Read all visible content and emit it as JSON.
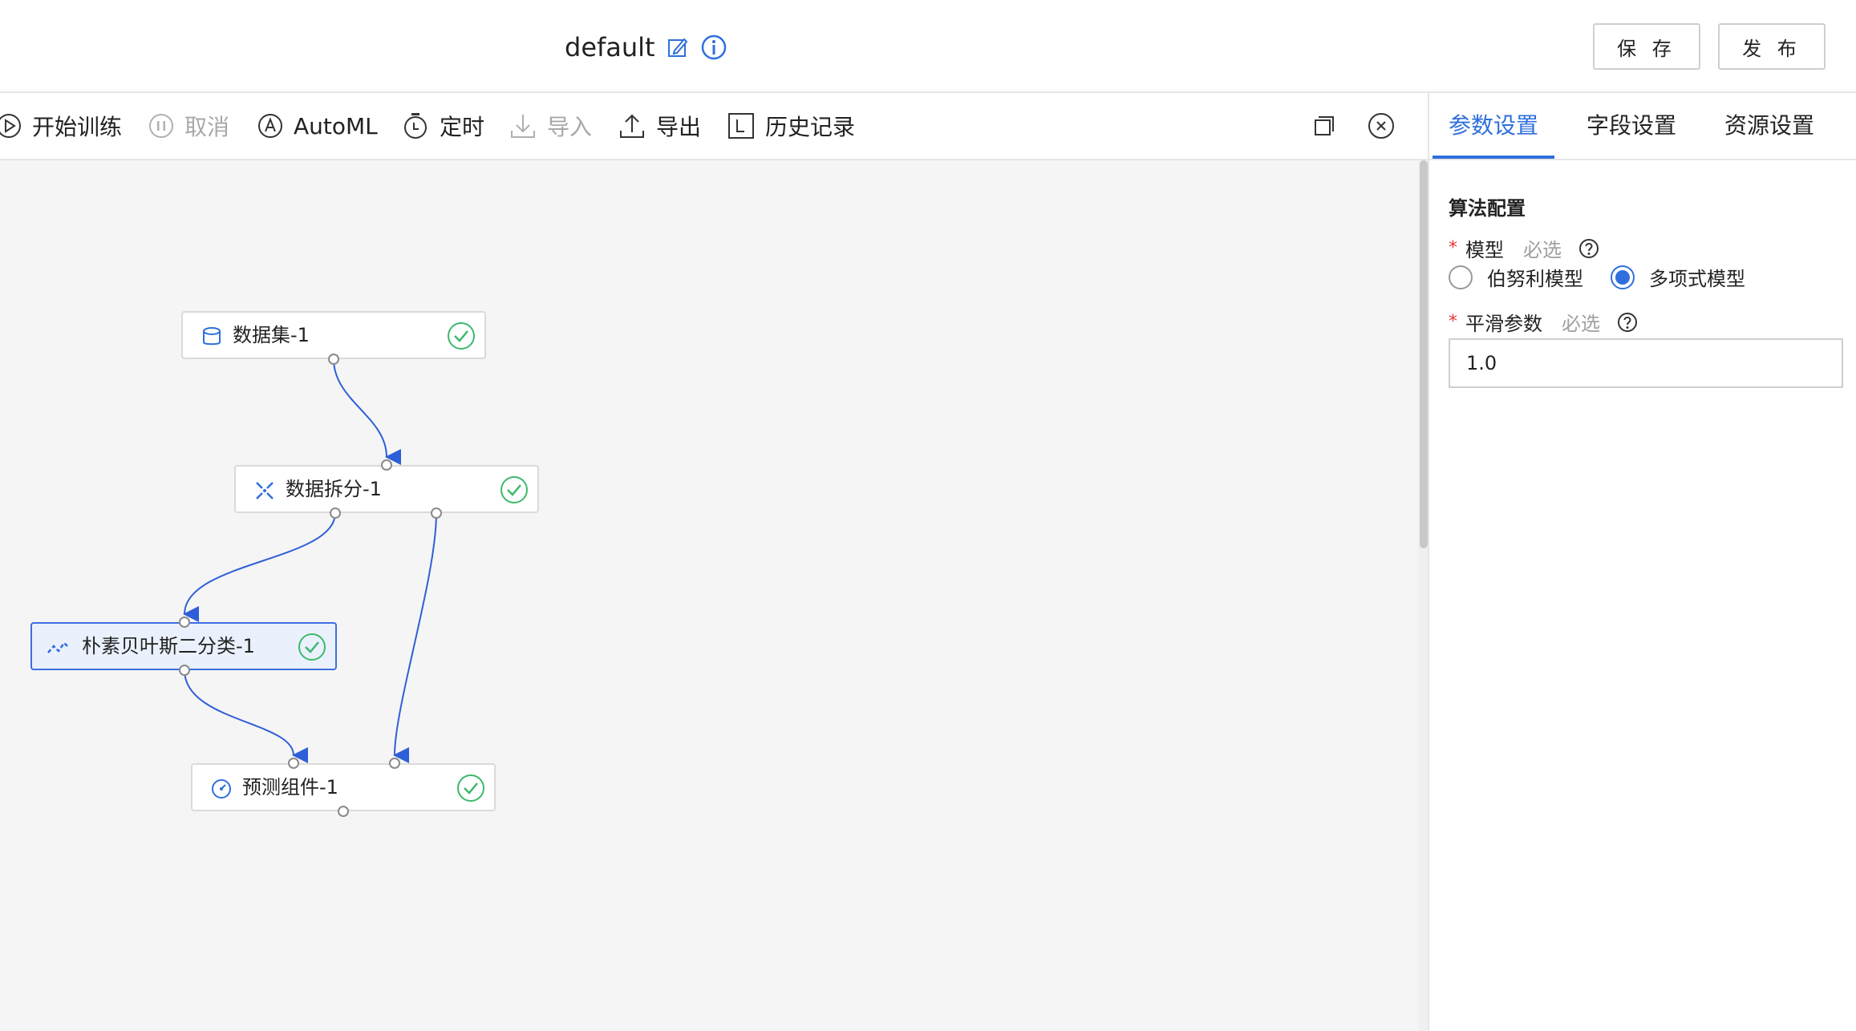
{
  "header": {
    "title": "default",
    "save_label": "保 存",
    "publish_label": "发 布"
  },
  "toolbar": {
    "start_training": "开始训练",
    "cancel": "取消",
    "automl": "AutoML",
    "schedule": "定时",
    "import": "导入",
    "export": "导出",
    "history": "历史记录"
  },
  "pipeline": {
    "nodes": [
      {
        "label": "数据集-1",
        "icon": "database-icon",
        "status": "success"
      },
      {
        "label": "数据拆分-1",
        "icon": "split-icon",
        "status": "success"
      },
      {
        "label": "朴素贝叶斯二分类-1",
        "icon": "algorithm-icon",
        "status": "success",
        "selected": true
      },
      {
        "label": "预测组件-1",
        "icon": "predict-icon",
        "status": "success"
      }
    ]
  },
  "panel": {
    "tabs": [
      "参数设置",
      "字段设置",
      "资源设置"
    ],
    "active_tab": "参数设置",
    "section_title": "算法配置",
    "model_field": {
      "label": "模型",
      "hint": "必选",
      "options": [
        "伯努利模型",
        "多项式模型"
      ],
      "selected": "多项式模型"
    },
    "smoothing_field": {
      "label": "平滑参数",
      "hint": "必选",
      "value": "1.0"
    }
  },
  "colors": {
    "accent": "#2f6fdc",
    "success": "#3cb96b",
    "required": "#e53935"
  }
}
